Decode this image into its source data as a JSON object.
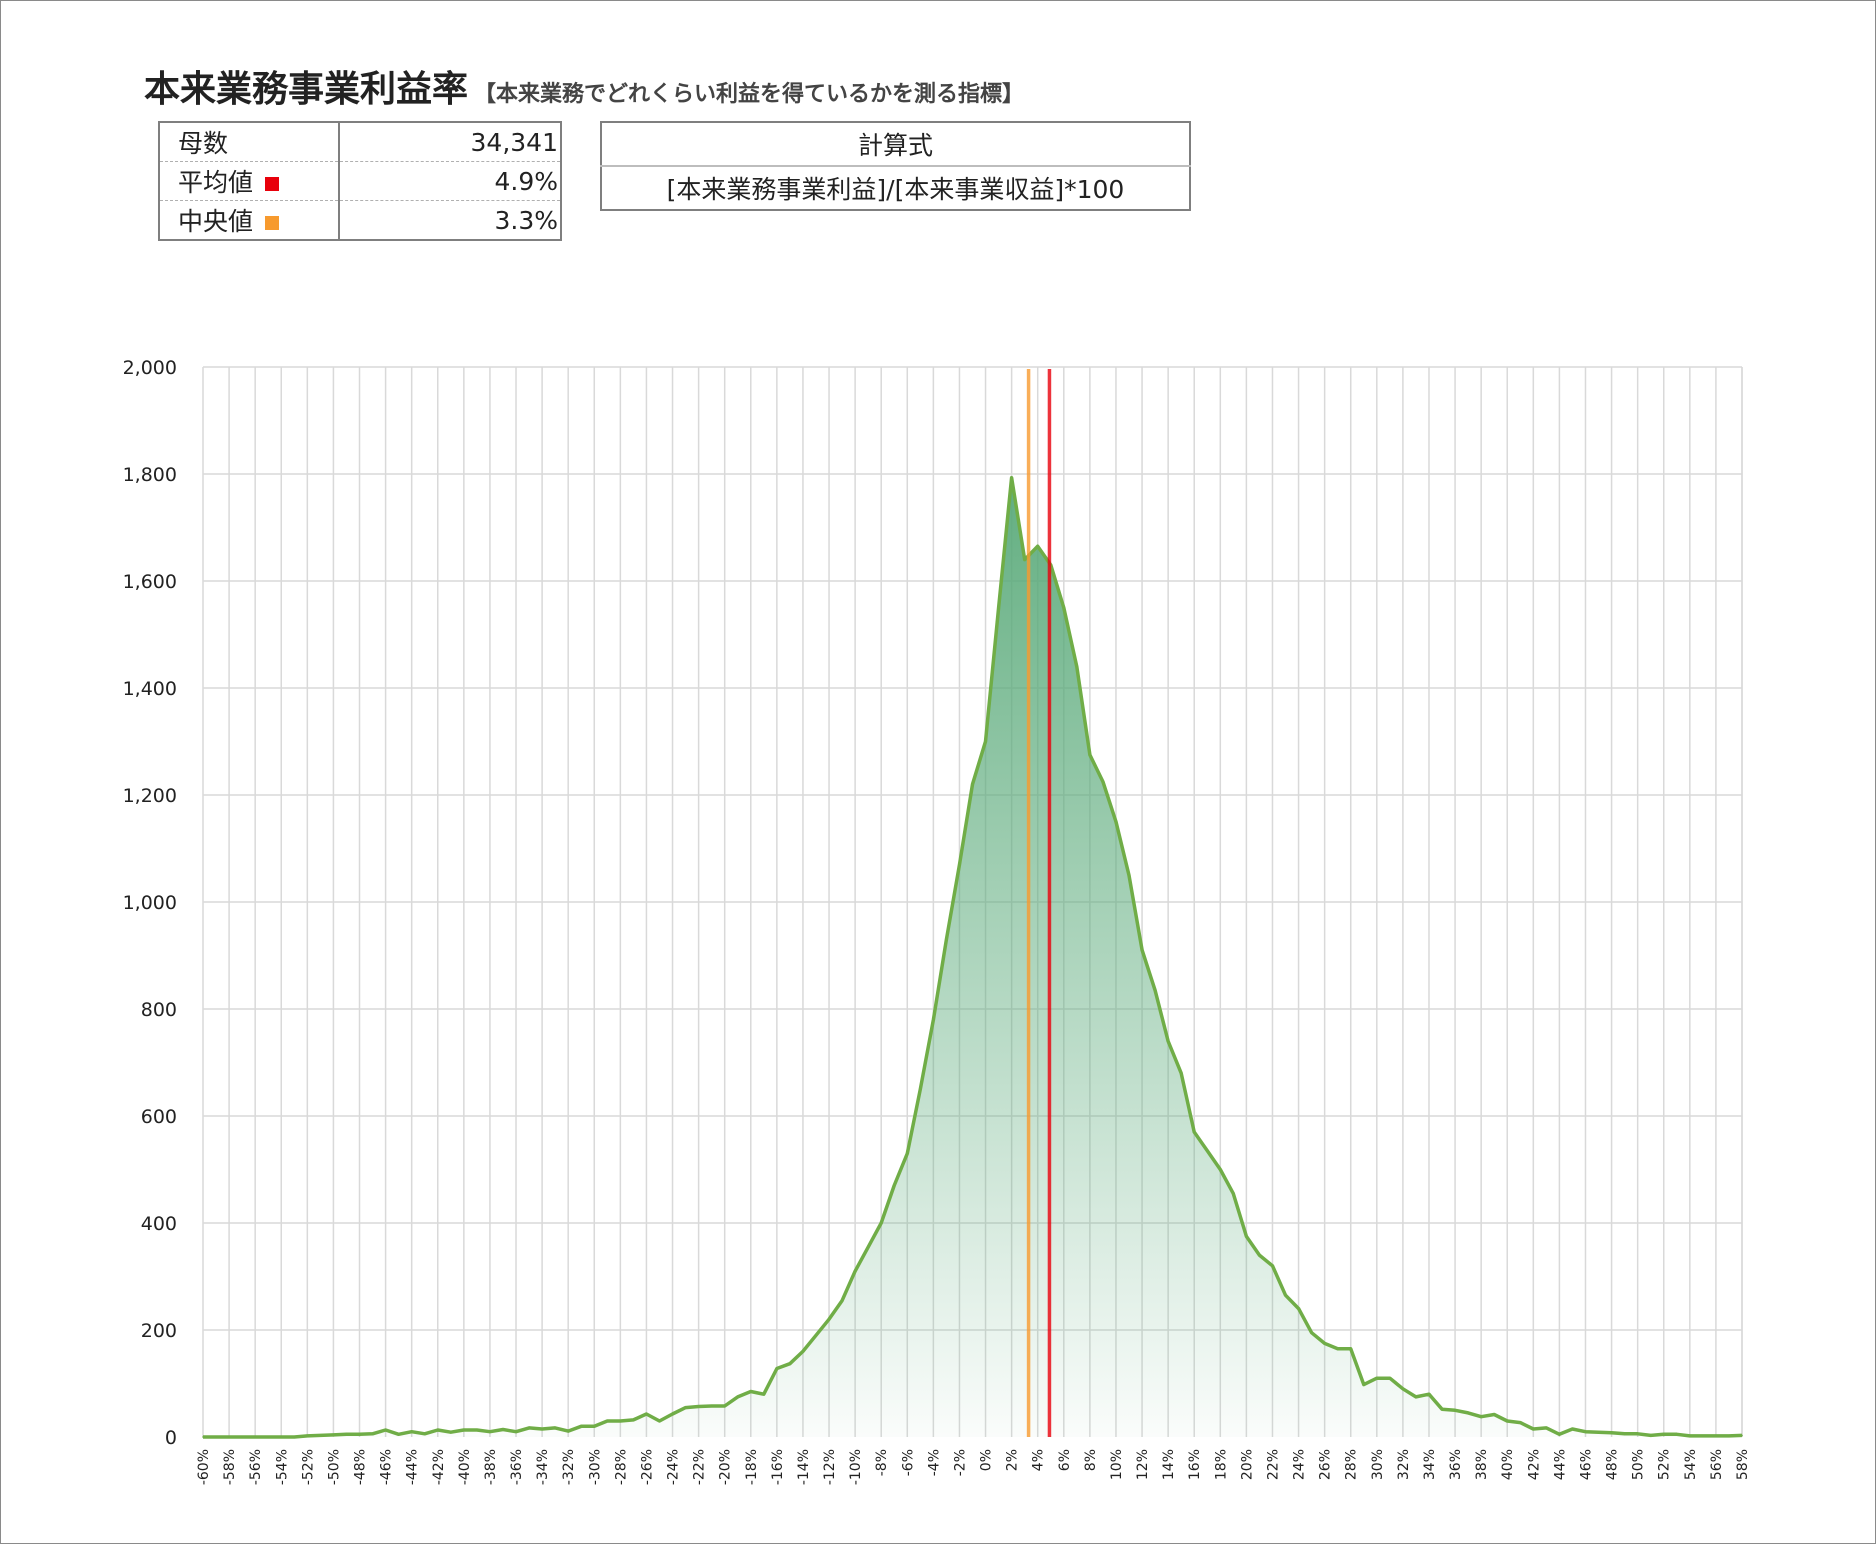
{
  "header": {
    "title": "本来業務事業利益率",
    "subtitle": "【本来業務でどれくらい利益を得ているかを測る指標】"
  },
  "stats": {
    "count_label": "母数",
    "count_value": "34,341",
    "mean_label": "平均値",
    "mean_value": "4.9%",
    "median_label": "中央値",
    "median_value": "3.3%"
  },
  "formula": {
    "header": "計算式",
    "expression": "[本来業務事業利益]/[本来事業収益]*100"
  },
  "colors": {
    "mean": "#e8000b",
    "median": "#f79a2e",
    "line": "#70ad47",
    "fill_top": "#5aaa7a",
    "fill_bottom": "#ffffff",
    "grid": "#d9d9d9"
  },
  "chart_data": {
    "type": "area",
    "x_unit": "%",
    "x_tick_labels": [
      "-60%",
      "-58%",
      "-56%",
      "-54%",
      "-52%",
      "-50%",
      "-48%",
      "-46%",
      "-44%",
      "-42%",
      "-40%",
      "-38%",
      "-36%",
      "-34%",
      "-32%",
      "-30%",
      "-28%",
      "-26%",
      "-24%",
      "-22%",
      "-20%",
      "-18%",
      "-16%",
      "-14%",
      "-12%",
      "-10%",
      "-8%",
      "-6%",
      "-4%",
      "-2%",
      "0%",
      "2%",
      "4%",
      "6%",
      "8%",
      "10%",
      "12%",
      "14%",
      "16%",
      "18%",
      "20%",
      "22%",
      "24%",
      "26%",
      "28%",
      "30%",
      "32%",
      "34%",
      "36%",
      "38%",
      "40%",
      "42%",
      "44%",
      "46%",
      "48%",
      "50%",
      "52%",
      "54%",
      "56%",
      "58%"
    ],
    "y_tick_labels": [
      "0",
      "200",
      "400",
      "600",
      "800",
      "1,000",
      "1,200",
      "1,400",
      "1,600",
      "1,800",
      "2,000"
    ],
    "ylim": [
      0,
      2000
    ],
    "xlim": [
      -60,
      58
    ],
    "grid": true,
    "x": [
      -60,
      -59,
      -58,
      -57,
      -56,
      -55,
      -54,
      -53,
      -52,
      -51,
      -50,
      -49,
      -48,
      -47,
      -46,
      -45,
      -44,
      -43,
      -42,
      -41,
      -40,
      -39,
      -38,
      -37,
      -36,
      -35,
      -34,
      -33,
      -32,
      -31,
      -30,
      -29,
      -28,
      -27,
      -26,
      -25,
      -24,
      -23,
      -22,
      -21,
      -20,
      -19,
      -18,
      -17,
      -16,
      -15,
      -14,
      -13,
      -12,
      -11,
      -10,
      -9,
      -8,
      -7,
      -6,
      -5,
      -4,
      -3,
      -2,
      -1,
      0,
      1,
      2,
      3,
      4,
      5,
      6,
      7,
      8,
      9,
      10,
      11,
      12,
      13,
      14,
      15,
      16,
      17,
      18,
      19,
      20,
      21,
      22,
      23,
      24,
      25,
      26,
      27,
      28,
      29,
      30,
      31,
      32,
      33,
      34,
      35,
      36,
      37,
      38,
      39,
      40,
      41,
      42,
      43,
      44,
      45,
      46,
      47,
      48,
      49,
      50,
      51,
      52,
      53,
      54,
      55,
      56,
      57,
      58
    ],
    "values": [
      0,
      0,
      0,
      0,
      0,
      0,
      0,
      0,
      2,
      3,
      4,
      5,
      5,
      6,
      13,
      5,
      10,
      6,
      13,
      9,
      13,
      13,
      10,
      14,
      10,
      17,
      15,
      17,
      11,
      20,
      20,
      30,
      30,
      32,
      43,
      30,
      43,
      55,
      57,
      58,
      58,
      75,
      85,
      80,
      128,
      137,
      160,
      190,
      220,
      255,
      310,
      355,
      400,
      470,
      530,
      650,
      780,
      930,
      1070,
      1220,
      1300,
      1550,
      1793,
      1640,
      1665,
      1630,
      1550,
      1440,
      1275,
      1225,
      1150,
      1050,
      910,
      835,
      740,
      680,
      570,
      535,
      500,
      455,
      375,
      340,
      320,
      265,
      240,
      195,
      175,
      165,
      165,
      98,
      110,
      110,
      90,
      75,
      80,
      52,
      50,
      45,
      38,
      42,
      30,
      27,
      15,
      17,
      5,
      15,
      10,
      9,
      8,
      6,
      6,
      3,
      5,
      5,
      2,
      2,
      2,
      2,
      3,
      3
    ],
    "reference_lines": [
      {
        "label": "平均値",
        "value": 4.9
      },
      {
        "label": "中央値",
        "value": 3.3
      }
    ]
  }
}
